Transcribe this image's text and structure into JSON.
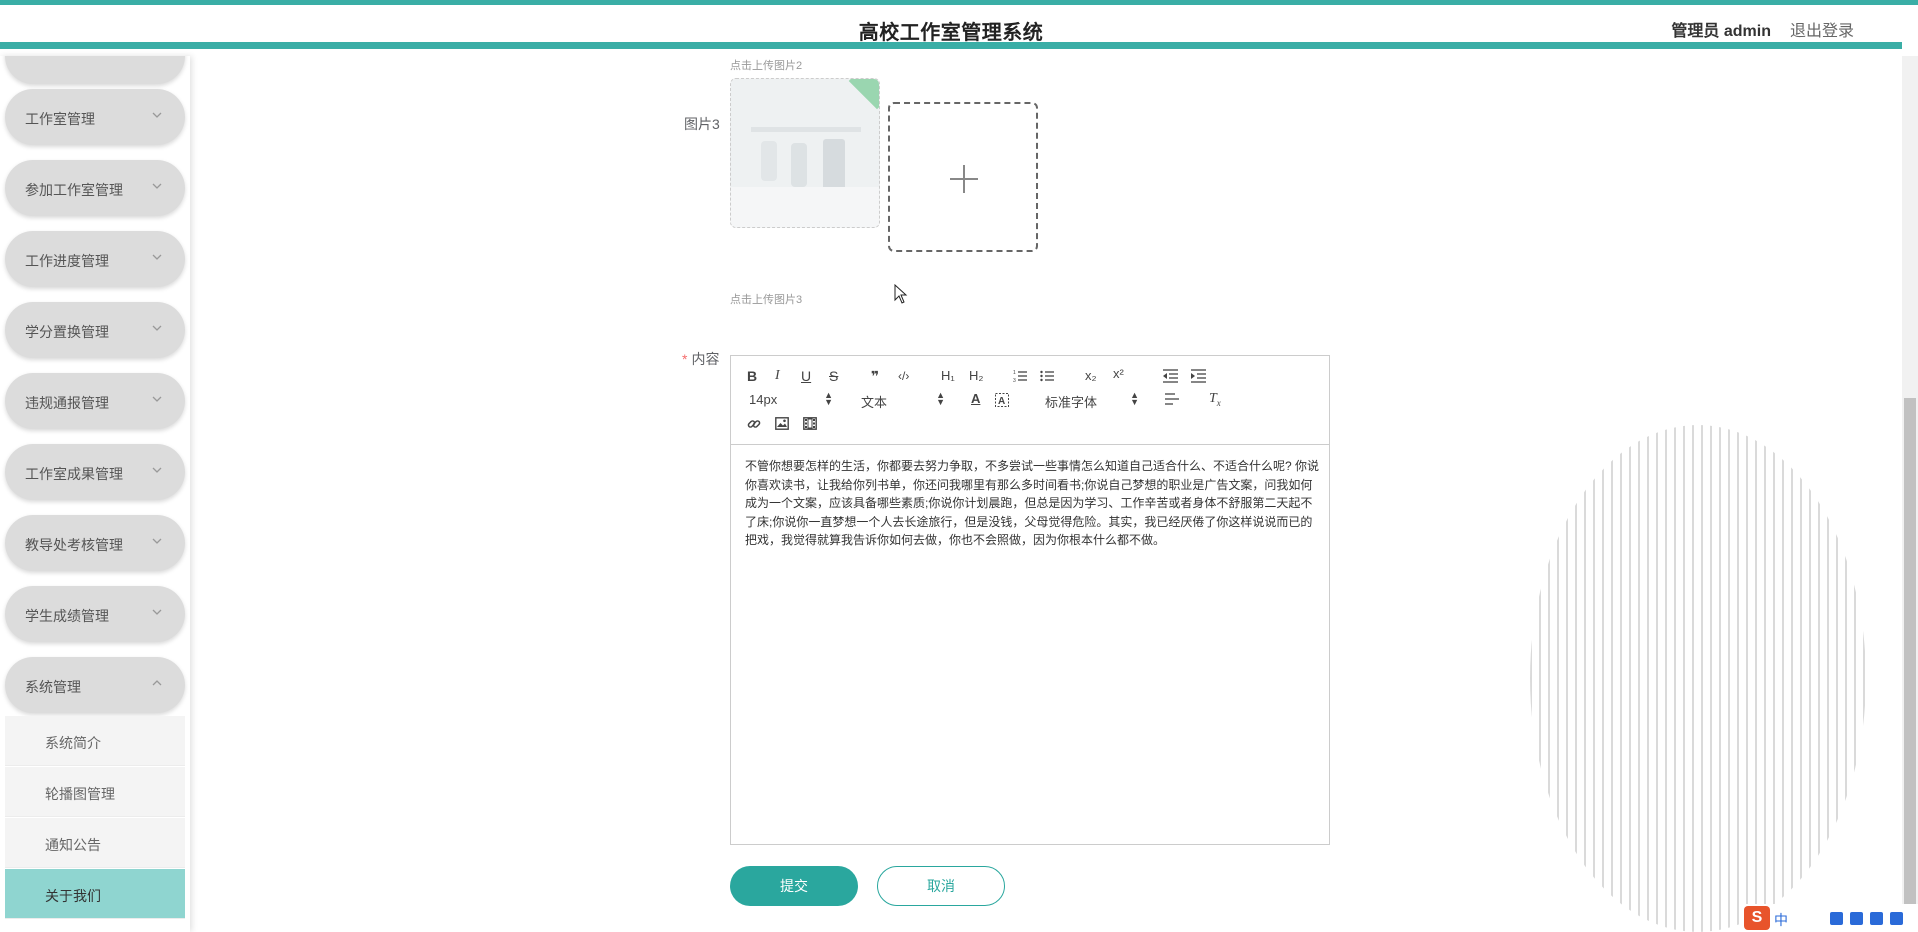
{
  "header": {
    "title": "高校工作室管理系统",
    "user": "管理员 admin",
    "logout": "退出登录"
  },
  "sidebar": {
    "menus": [
      {
        "label": "工作室管理"
      },
      {
        "label": "参加工作室管理"
      },
      {
        "label": "工作进度管理"
      },
      {
        "label": "学分置换管理"
      },
      {
        "label": "违规通报管理"
      },
      {
        "label": "工作室成果管理"
      },
      {
        "label": "教导处考核管理"
      },
      {
        "label": "学生成绩管理"
      },
      {
        "label": "系统管理"
      }
    ],
    "submenu": [
      {
        "label": "系统简介"
      },
      {
        "label": "轮播图管理"
      },
      {
        "label": "通知公告"
      },
      {
        "label": "关于我们"
      }
    ]
  },
  "form": {
    "hint_image2": "点击上传图片2",
    "label_image3": "图片3",
    "hint_image3": "点击上传图片3",
    "label_content": "内容",
    "required_mark": "*"
  },
  "editor": {
    "font_size": "14px",
    "header": "文本",
    "font_family": "标准字体",
    "content": "不管你想要怎样的生活，你都要去努力争取，不多尝试一些事情怎么知道自己适合什么、不适合什么呢? 你说你喜欢读书，让我给你列书单，你还问我哪里有那么多时间看书;你说自己梦想的职业是广告文案，问我如何成为一个文案，应该具备哪些素质;你说你计划晨跑，但总是因为学习、工作辛苦或者身体不舒服第二天起不了床;你说你一直梦想一个人去长途旅行，但是没钱，父母觉得危险。其实，我已经厌倦了你这样说说而已的把戏，我觉得就算我告诉你如何去做，你也不会照做，因为你根本什么都不做。"
  },
  "buttons": {
    "submit": "提交",
    "cancel": "取消"
  },
  "ime": {
    "lang": "中"
  },
  "colors": {
    "accent": "#3aaea6",
    "primary_button": "#2aa79e",
    "active_menu": "#8fd5d0"
  }
}
